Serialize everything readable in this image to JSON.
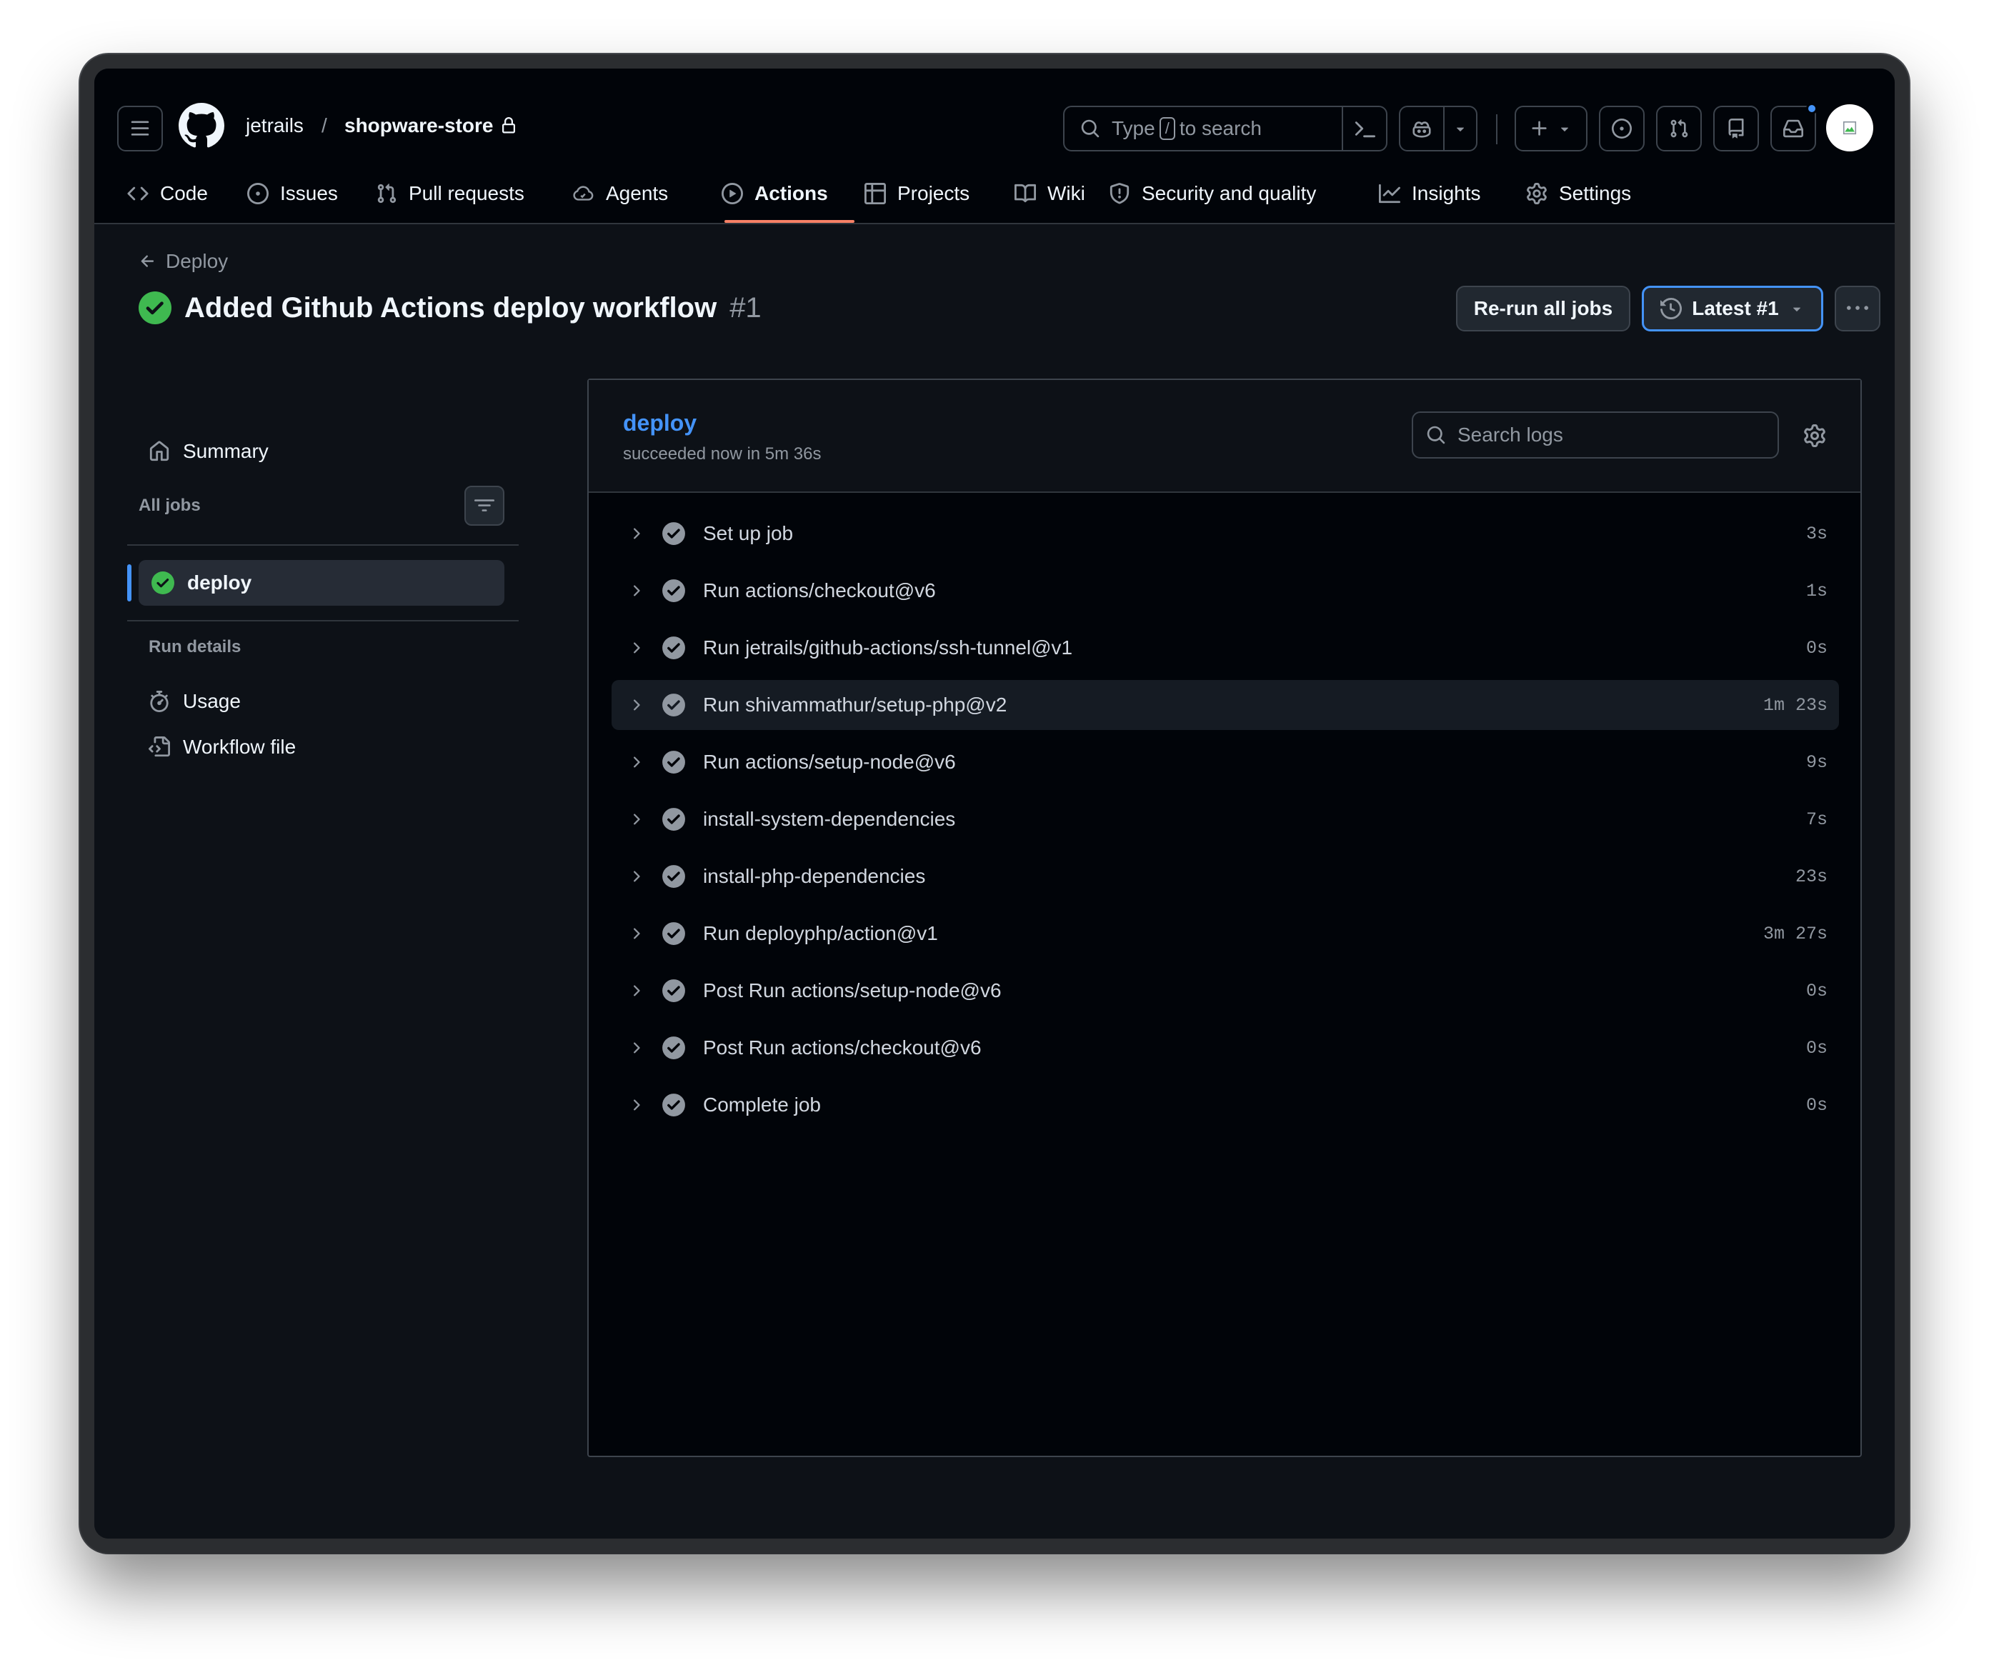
{
  "header": {
    "owner": "jetrails",
    "separator": "/",
    "repo": "shopware-store",
    "search": {
      "prefix": "Type",
      "key": "/",
      "suffix": "to search"
    }
  },
  "tabs": [
    {
      "label": "Code",
      "icon": "code-icon"
    },
    {
      "label": "Issues",
      "icon": "issue-opened-icon"
    },
    {
      "label": "Pull requests",
      "icon": "git-pull-request-icon"
    },
    {
      "label": "Agents",
      "icon": "agent-icon"
    },
    {
      "label": "Actions",
      "icon": "play-icon",
      "active": true
    },
    {
      "label": "Projects",
      "icon": "table-icon"
    },
    {
      "label": "Wiki",
      "icon": "book-icon"
    },
    {
      "label": "Security and quality",
      "icon": "shield-icon"
    },
    {
      "label": "Insights",
      "icon": "graph-icon"
    },
    {
      "label": "Settings",
      "icon": "gear-icon"
    }
  ],
  "run": {
    "back_label": "Deploy",
    "title": "Added Github Actions deploy workflow",
    "number": "#1",
    "rerun_label": "Re-run all jobs",
    "latest_label": "Latest #1"
  },
  "sidebar": {
    "summary": "Summary",
    "all_jobs": "All jobs",
    "job": "deploy",
    "run_details": "Run details",
    "usage": "Usage",
    "workflow_file": "Workflow file"
  },
  "job": {
    "name": "deploy",
    "status": "succeeded now in 5m 36s",
    "search_placeholder": "Search logs",
    "steps": [
      {
        "name": "Set up job",
        "duration": "3s"
      },
      {
        "name": "Run actions/checkout@v6",
        "duration": "1s"
      },
      {
        "name": "Run jetrails/github-actions/ssh-tunnel@v1",
        "duration": "0s"
      },
      {
        "name": "Run shivammathur/setup-php@v2",
        "duration": "1m 23s"
      },
      {
        "name": "Run actions/setup-node@v6",
        "duration": "9s"
      },
      {
        "name": "install-system-dependencies",
        "duration": "7s"
      },
      {
        "name": "install-php-dependencies",
        "duration": "23s"
      },
      {
        "name": "Run deployphp/action@v1",
        "duration": "3m 27s"
      },
      {
        "name": "Post Run actions/setup-node@v6",
        "duration": "0s"
      },
      {
        "name": "Post Run actions/checkout@v6",
        "duration": "0s"
      },
      {
        "name": "Complete job",
        "duration": "0s"
      }
    ]
  },
  "colors": {
    "accent": "#4493f8",
    "success": "#3fb950",
    "active_tab_underline": "#f78166",
    "background": "#0d1117"
  }
}
